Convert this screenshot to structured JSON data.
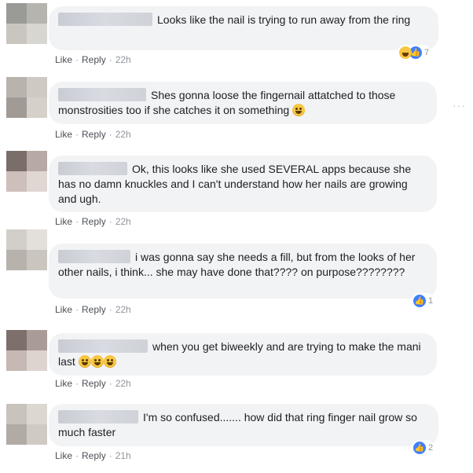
{
  "comments": [
    {
      "text": "Looks like the nail is trying to run away from the ring",
      "emoji": "",
      "like": "Like",
      "reply": "Reply",
      "time": "22h",
      "reactions": "7",
      "reaction_type": "haha-like"
    },
    {
      "text": "Shes gonna loose the fingernail attatched to those monstrosities too if she catches it on something",
      "emoji": "grin",
      "like": "Like",
      "reply": "Reply",
      "time": "22h",
      "reactions": "",
      "reaction_type": ""
    },
    {
      "text": "Ok, this looks like she used SEVERAL apps because she has no damn knuckles and I can't understand how her nails are growing and ugh.",
      "emoji": "",
      "like": "Like",
      "reply": "Reply",
      "time": "22h",
      "reactions": "",
      "reaction_type": ""
    },
    {
      "text": "i was gonna say she needs a fill, but from the looks of her other nails, i think... she may have done that???? on purpose????????",
      "emoji": "",
      "like": "Like",
      "reply": "Reply",
      "time": "22h",
      "reactions": "1",
      "reaction_type": "like"
    },
    {
      "text": "when you get biweekly and are trying to make the mani last",
      "emoji": "laugh x3",
      "like": "Like",
      "reply": "Reply",
      "time": "22h",
      "reactions": "",
      "reaction_type": ""
    },
    {
      "text": "I'm so confused....... how did that ring finger nail grow so much faster",
      "emoji": "",
      "like": "Like",
      "reply": "Reply",
      "time": "21h",
      "reactions": "2",
      "reaction_type": "like"
    }
  ],
  "more_label": "···",
  "colors": {
    "bubble": "#f2f3f5",
    "like_blue": "#4080ff",
    "meta": "#90949c"
  }
}
